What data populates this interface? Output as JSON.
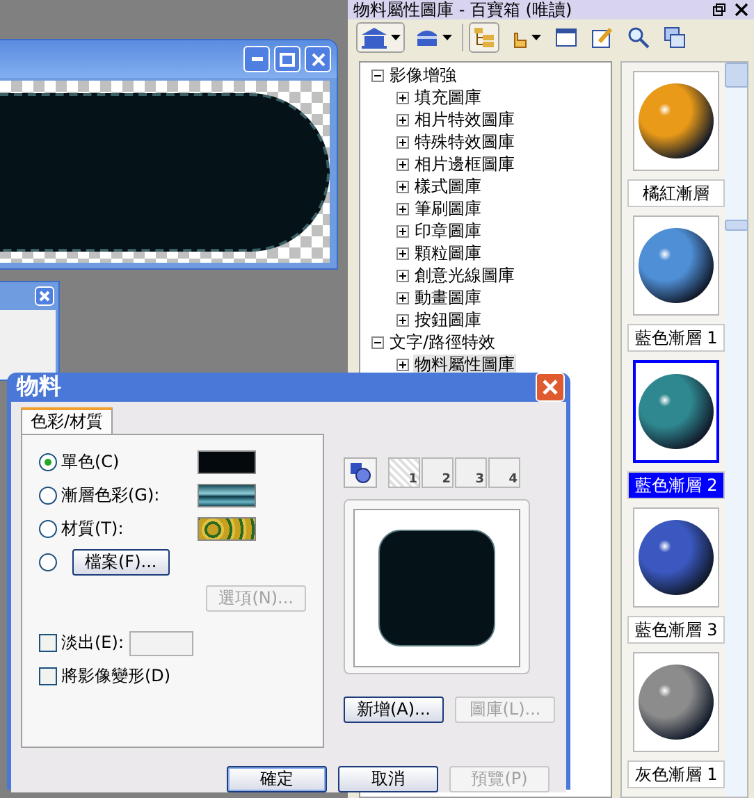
{
  "library_panel": {
    "title": "物料屬性圖庫 - 百寶箱 (唯讀)",
    "tree": [
      {
        "label": "影像增強",
        "expanded": true,
        "selected": false,
        "children": [
          {
            "label": "填充圖庫",
            "expanded": false,
            "selected": false
          },
          {
            "label": "相片特效圖庫",
            "expanded": false,
            "selected": false
          },
          {
            "label": "特殊特效圖庫",
            "expanded": false,
            "selected": false
          },
          {
            "label": "相片邊框圖庫",
            "expanded": false,
            "selected": false
          },
          {
            "label": "樣式圖庫",
            "expanded": false,
            "selected": false
          },
          {
            "label": "筆刷圖庫",
            "expanded": false,
            "selected": false
          },
          {
            "label": "印章圖庫",
            "expanded": false,
            "selected": false
          },
          {
            "label": "顆粒圖庫",
            "expanded": false,
            "selected": false
          },
          {
            "label": "創意光線圖庫",
            "expanded": false,
            "selected": false
          },
          {
            "label": "動畫圖庫",
            "expanded": false,
            "selected": false
          },
          {
            "label": "按鈕圖庫",
            "expanded": false,
            "selected": false
          }
        ]
      },
      {
        "label": "文字/路徑特效",
        "expanded": true,
        "selected": false,
        "children": [
          {
            "label": "物料屬性圖庫",
            "expanded": false,
            "selected": true
          }
        ]
      }
    ],
    "swatches": [
      {
        "label": "橘紅漸層",
        "color": "#e89a18",
        "selected": false
      },
      {
        "label": "藍色漸層 1",
        "color": "#4f8fd6",
        "selected": false
      },
      {
        "label": "藍色漸層 2",
        "color": "#2f8890",
        "selected": true
      },
      {
        "label": "藍色漸層 3",
        "color": "#3a58c0",
        "selected": false
      },
      {
        "label": "灰色漸層 1",
        "color": "#8c8c8c",
        "selected": false
      }
    ]
  },
  "dialog": {
    "title": "物料",
    "tabs": [
      {
        "label": "色彩/材質",
        "selected": true
      }
    ],
    "fill_options": [
      {
        "kind": "solid",
        "label": "單色(C)",
        "selected": true
      },
      {
        "kind": "gradient",
        "label": "漸層色彩(G):",
        "selected": false
      },
      {
        "kind": "texture",
        "label": "材質(T):",
        "selected": false
      },
      {
        "kind": "file",
        "button": "檔案(F)...",
        "selected": false
      }
    ],
    "options_button": {
      "label": "選項(N)...",
      "disabled": true
    },
    "checkboxes": [
      {
        "label": "淡出(E):",
        "checked": false,
        "field": true
      },
      {
        "label": "將影像變形(D)",
        "checked": false,
        "field": false
      }
    ],
    "layers": [
      {
        "label": "1",
        "selected": true
      },
      {
        "label": "2",
        "selected": false
      },
      {
        "label": "3",
        "selected": false
      },
      {
        "label": "4",
        "selected": false
      }
    ],
    "side_buttons": [
      {
        "label": "新增(A)...",
        "disabled": false
      },
      {
        "label": "圖庫(L)...",
        "disabled": true
      }
    ],
    "buttons": [
      {
        "label": "確定",
        "disabled": false,
        "default": true
      },
      {
        "label": "取消",
        "disabled": false,
        "default": false
      },
      {
        "label": "預覽(P)",
        "disabled": true,
        "default": false
      }
    ]
  }
}
